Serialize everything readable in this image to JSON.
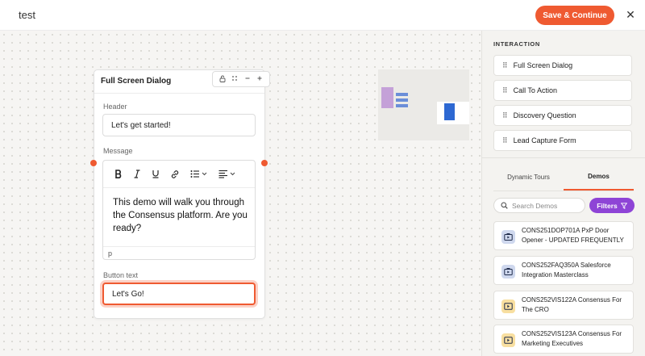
{
  "header": {
    "title": "test",
    "save_label": "Save & Continue",
    "close_glyph": "✕"
  },
  "dialog": {
    "title": "Full Screen Dialog",
    "tools": [
      "lock-icon",
      "drag-icon",
      "minus-icon",
      "plus-icon"
    ],
    "header_label": "Header",
    "header_value": "Let's get started!",
    "message_label": "Message",
    "message_text": "This demo will walk you through the Consensus platform. Are you ready?",
    "editor_footer": "p",
    "button_label": "Button text",
    "button_value": "Let's Go!"
  },
  "sidebar": {
    "section_title": "INTERACTION",
    "interaction_items": [
      {
        "label": "Full Screen Dialog"
      },
      {
        "label": "Call To Action"
      },
      {
        "label": "Discovery Question"
      },
      {
        "label": "Lead Capture Form"
      }
    ],
    "tabs": [
      {
        "label": "Dynamic Tours",
        "active": false
      },
      {
        "label": "Demos",
        "active": true
      }
    ],
    "search_placeholder": "Search Demos",
    "filters_label": "Filters",
    "demos": [
      {
        "title": "CONS251DOP701A PxP Door Opener - UPDATED FREQUENTLY",
        "icon": "demo-icon",
        "color": "#cfd8ee"
      },
      {
        "title": "CONS252FAQ350A Salesforce Integration Masterclass",
        "icon": "demo-icon",
        "color": "#cfd8ee"
      },
      {
        "title": "CONS252VIS122A Consensus For The CRO",
        "icon": "video-icon",
        "color": "#f8dfa0"
      },
      {
        "title": "CONS252VIS123A Consensus For Marketing Executives",
        "icon": "video-icon",
        "color": "#f8dfa0"
      }
    ]
  },
  "colors": {
    "accent": "#ef5a31",
    "filters": "#8e44d6"
  }
}
